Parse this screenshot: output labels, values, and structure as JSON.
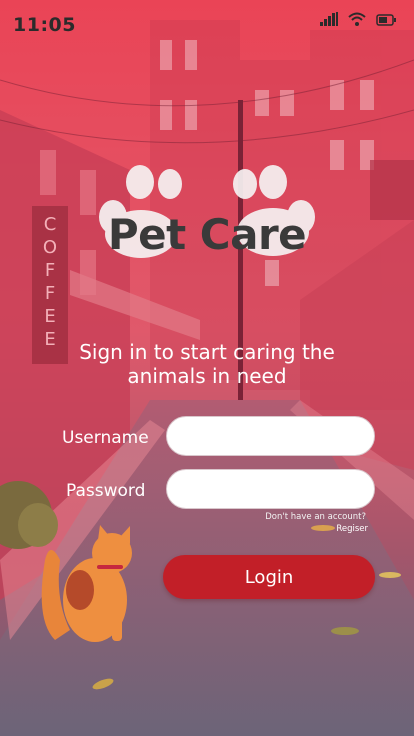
{
  "status_bar": {
    "time": "11:05",
    "icons": [
      "signal-icon",
      "wifi-icon",
      "battery-icon"
    ]
  },
  "background": {
    "sign_text": "COFFEE"
  },
  "logo": {
    "icon": "paw-icon",
    "title": "Pet Care"
  },
  "tagline": "Sign in to start caring the animals in need",
  "form": {
    "username_label": "Username",
    "username_value": "",
    "password_label": "Password",
    "password_value": "",
    "no_account_text": "Don't have an account?",
    "register_label": "Regiser",
    "login_label": "Login"
  },
  "colors": {
    "primary": "#c21f28",
    "background_top": "#e8475a",
    "background_bottom": "#6a5f77"
  }
}
